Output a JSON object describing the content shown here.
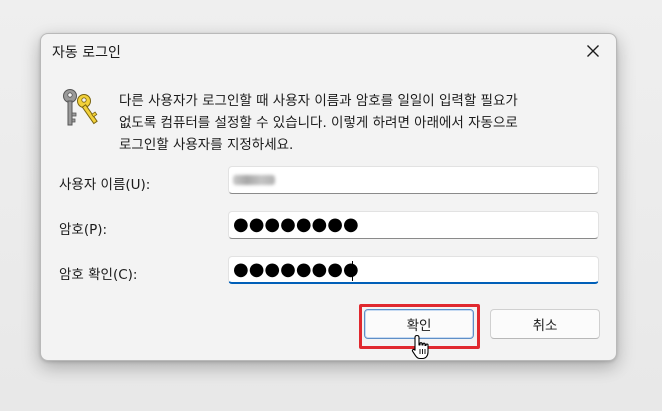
{
  "dialog": {
    "title": "자동 로그인",
    "close_glyph": "✕",
    "description_lines": [
      "다른 사용자가 로그인할 때 사용자 이름과 암호를 일일이 입력할 필요가",
      "없도록 컴퓨터를 설정할 수 있습니다. 이렇게 하려면 아래에서 자동으로",
      "로그인할 사용자를 지정하세요."
    ]
  },
  "fields": {
    "username": {
      "label": "사용자 이름(U):"
    },
    "password": {
      "label": "암호(P):",
      "value": "●●●●●●●●"
    },
    "confirm": {
      "label": "암호 확인(C):",
      "value": "●●●●●●●●"
    }
  },
  "buttons": {
    "ok": "확인",
    "cancel": "취소"
  },
  "colors": {
    "accent": "#005fb8",
    "highlight": "#e0282e"
  },
  "icons": {
    "dialog_icon": "keys-icon",
    "close": "close-icon",
    "pointer": "hand-pointer-icon"
  }
}
